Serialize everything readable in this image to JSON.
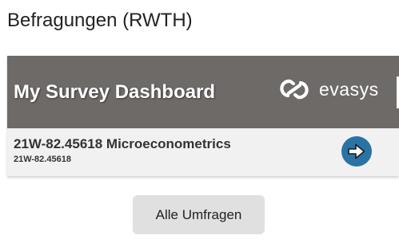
{
  "page": {
    "title": "Befragungen (RWTH)"
  },
  "dashboard": {
    "title": "My Survey Dashboard",
    "brand": "evasys",
    "header_color": "#6e6a68",
    "surveys": [
      {
        "title": "21W-82.45618 Microeconometrics",
        "code": "21W-82.45618",
        "action_icon": "arrow-right-circle-icon",
        "action_color": "#2a73a5"
      }
    ]
  },
  "actions": {
    "all_surveys_label": "Alle Umfragen"
  }
}
